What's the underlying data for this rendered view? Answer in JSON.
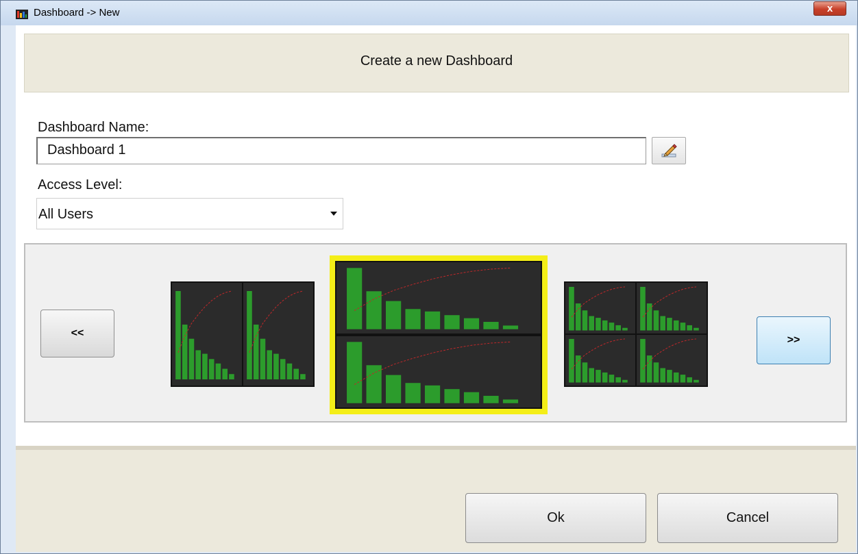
{
  "window": {
    "title": "Dashboard -> New",
    "close_label": "x"
  },
  "header": {
    "title": "Create a new Dashboard"
  },
  "form": {
    "name_label": "Dashboard Name:",
    "name_value": "Dashboard 1",
    "access_label": "Access Level:",
    "access_value": "All Users"
  },
  "carousel": {
    "prev_label": "<<",
    "next_label": ">>",
    "layouts": [
      {
        "name": "two-column",
        "panels": 2,
        "selected": false
      },
      {
        "name": "two-row",
        "panels": 2,
        "selected": true
      },
      {
        "name": "grid-2x2",
        "panels": 4,
        "selected": false
      }
    ],
    "highlight_color": "#f4ee18"
  },
  "buttons": {
    "ok_label": "Ok",
    "cancel_label": "Cancel"
  },
  "thumb_bar_values": [
    1.0,
    0.62,
    0.46,
    0.33,
    0.29,
    0.23,
    0.18,
    0.12,
    0.06
  ],
  "colors": {
    "bar": "#2c9c2c",
    "panel_bg": "#2b2b2b",
    "curve": "#c0282a"
  }
}
